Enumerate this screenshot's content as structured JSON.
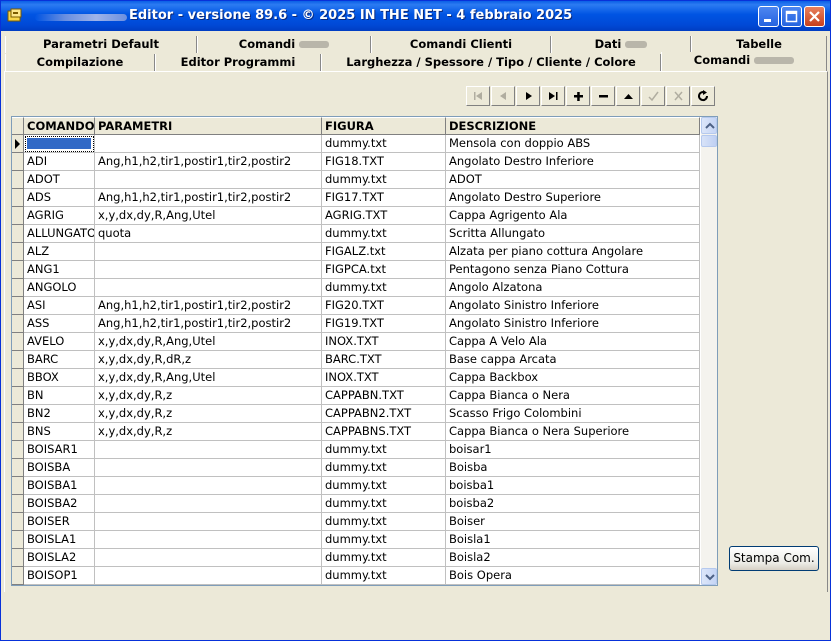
{
  "window": {
    "title": "Editor - versione 89.6 - © 2025  IN THE NET - 4 febbraio 2025"
  },
  "tabs_row1": [
    {
      "label": "Parametri Default"
    },
    {
      "label": "Comandi"
    },
    {
      "label": "Comandi Clienti"
    },
    {
      "label": "Dati"
    },
    {
      "label": "Tabelle"
    }
  ],
  "tabs_row2": [
    {
      "label": "Compilazione"
    },
    {
      "label": "Editor Programmi"
    },
    {
      "label": "Larghezza / Spessore / Tipo / Cliente / Colore"
    },
    {
      "label": "Comandi",
      "active": true
    }
  ],
  "navigator": {
    "buttons": [
      "first-icon",
      "prior-icon",
      "next-icon",
      "last-icon",
      "insert-icon",
      "delete-icon",
      "edit-icon",
      "post-icon",
      "cancel-icon",
      "refresh-icon"
    ]
  },
  "grid": {
    "columns": [
      "COMANDO",
      "PARAMETRI",
      "FIGURA",
      "DESCRIZIONE"
    ],
    "rows": [
      [
        "",
        "",
        "dummy.txt",
        "Mensola con doppio ABS"
      ],
      [
        "ADI",
        "Ang,h1,h2,tir1,postir1,tir2,postir2",
        "FIG18.TXT",
        "Angolato Destro Inferiore"
      ],
      [
        "ADOT",
        "",
        "dummy.txt",
        "ADOT"
      ],
      [
        "ADS",
        "Ang,h1,h2,tir1,postir1,tir2,postir2",
        "FIG17.TXT",
        "Angolato Destro Superiore"
      ],
      [
        "AGRIG",
        "x,y,dx,dy,R,Ang,Utel",
        "AGRIG.TXT",
        "Cappa Agrigento Ala"
      ],
      [
        "ALLUNGATO",
        "quota",
        "dummy.txt",
        "Scritta Allungato"
      ],
      [
        "ALZ",
        "",
        "FIGALZ.txt",
        "Alzata per piano cottura Angolare"
      ],
      [
        "ANG1",
        "",
        "FIGPCA.txt",
        "Pentagono senza Piano Cottura"
      ],
      [
        "ANGOLO",
        "",
        "dummy.txt",
        "Angolo Alzatona"
      ],
      [
        "ASI",
        "Ang,h1,h2,tir1,postir1,tir2,postir2",
        "FIG20.TXT",
        "Angolato Sinistro Inferiore"
      ],
      [
        "ASS",
        "Ang,h1,h2,tir1,postir1,tir2,postir2",
        "FIG19.TXT",
        "Angolato Sinistro Inferiore"
      ],
      [
        "AVELO",
        "x,y,dx,dy,R,Ang,Utel",
        "INOX.TXT",
        "Cappa A Velo Ala"
      ],
      [
        "BARC",
        "x,y,dx,dy,R,dR,z",
        "BARC.TXT",
        "Base cappa Arcata"
      ],
      [
        "BBOX",
        "x,y,dx,dy,R,Ang,Utel",
        "INOX.TXT",
        "Cappa Backbox"
      ],
      [
        "BN",
        "x,y,dx,dy,R,z",
        "CAPPABN.TXT",
        "Cappa Bianca o Nera"
      ],
      [
        "BN2",
        "x,y,dx,dy,R,z",
        "CAPPABN2.TXT",
        "Scasso Frigo Colombini"
      ],
      [
        "BNS",
        "x,y,dx,dy,R,z",
        "CAPPABNS.TXT",
        "Cappa Bianca o Nera Superiore"
      ],
      [
        "BOISAR1",
        "",
        "dummy.txt",
        "boisar1"
      ],
      [
        "BOISBA",
        "",
        "dummy.txt",
        "Boisba"
      ],
      [
        "BOISBA1",
        "",
        "dummy.txt",
        "boisba1"
      ],
      [
        "BOISBA2",
        "",
        "dummy.txt",
        "boisba2"
      ],
      [
        "BOISER",
        "",
        "dummy.txt",
        "Boiser"
      ],
      [
        "BOISLA1",
        "",
        "dummy.txt",
        "Boisla1"
      ],
      [
        "BOISLA2",
        "",
        "dummy.txt",
        "Boisla2"
      ],
      [
        "BOISOP1",
        "",
        "dummy.txt",
        "Bois Opera"
      ]
    ]
  },
  "print_button": {
    "label": "Stampa Com."
  }
}
